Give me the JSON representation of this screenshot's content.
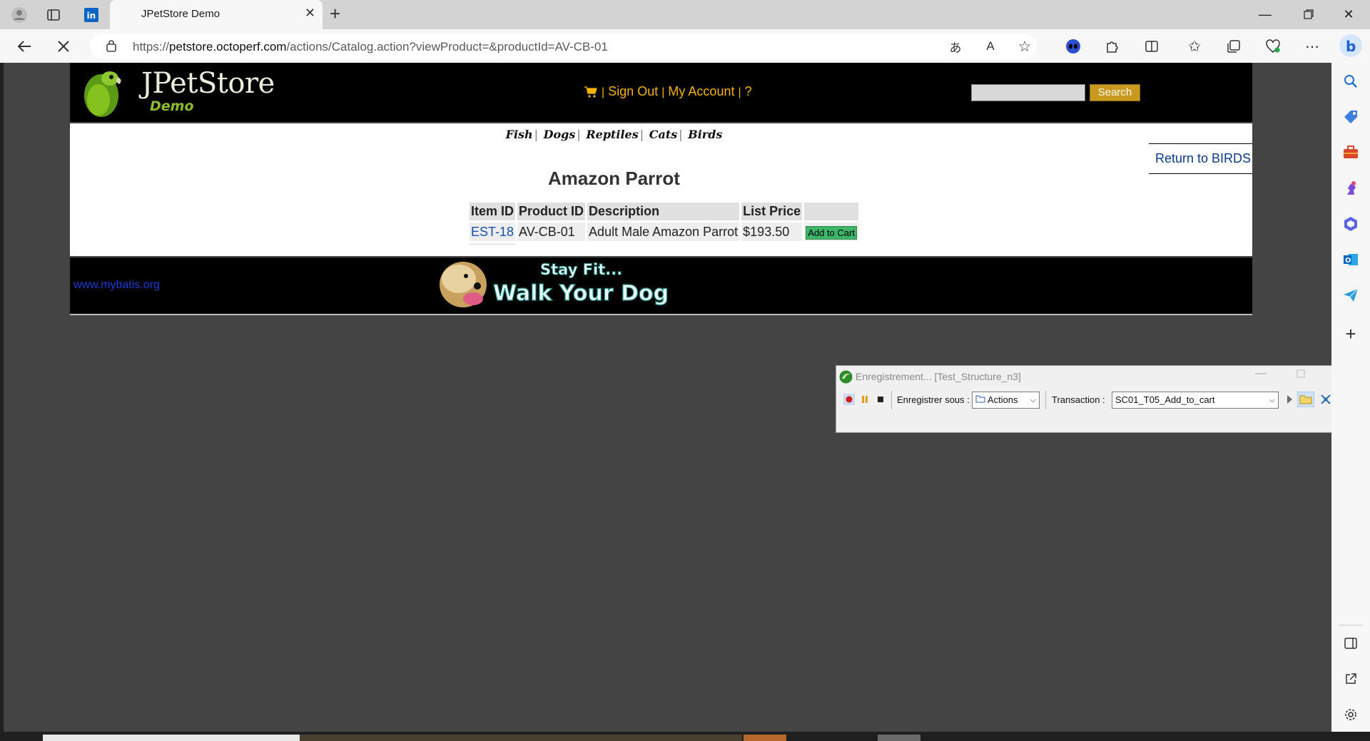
{
  "browser": {
    "tab_title": "JPetStore Demo",
    "url_prefix": "https://",
    "url_host": "petstore.octoperf.com",
    "url_path": "/actions/Catalog.action?viewProduct=&productId=AV-CB-01"
  },
  "site": {
    "logo_title": "JPetStore",
    "logo_sub": "Demo",
    "menu": {
      "sign_out": "Sign Out",
      "my_account": "My Account",
      "help": "?",
      "sep": "|"
    },
    "search_label": "Search",
    "categories": [
      "Fish",
      "Dogs",
      "Reptiles",
      "Cats",
      "Birds"
    ],
    "category_sep": "|",
    "return_link": "Return to BIRDS",
    "product_title": "Amazon Parrot",
    "table": {
      "headers": [
        "Item ID",
        "Product ID",
        "Description",
        "List Price"
      ],
      "rows": [
        {
          "item_id": "EST-18",
          "product_id": "AV-CB-01",
          "description": "Adult Male Amazon Parrot",
          "price": "$193.50",
          "action": "Add to Cart"
        }
      ]
    },
    "footer_link": "www.mybatis.org",
    "banner_line1": "Stay Fit...",
    "banner_line2": "Walk Your Dog!"
  },
  "recorder": {
    "title": "Enregistrement... [Test_Structure_n3]",
    "save_as_label": "Enregistrer sous :",
    "save_as_value": "Actions",
    "transaction_label": "Transaction :",
    "transaction_value": "SC01_T05_Add_to_cart"
  },
  "colors": {
    "header_bg": "#000000",
    "menu_text": "#f5b400",
    "add_cart": "#3fb56a",
    "link_blue": "#1650b0"
  }
}
